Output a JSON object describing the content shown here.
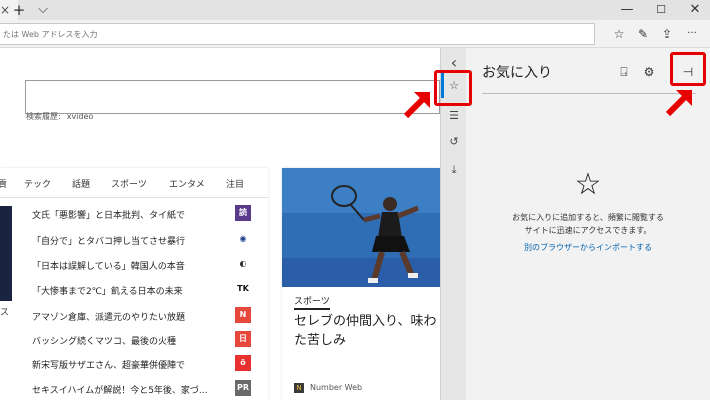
{
  "titlebar": {
    "new_tab_icon": "plus-icon",
    "new_tab_glyph": "+",
    "tab_list_glyph": "⌵",
    "tab_close_glyph": "×",
    "minimize_glyph": "—",
    "maximize_glyph": "☐",
    "close_glyph": "✕"
  },
  "address_bar": {
    "placeholder": "たは Web アドレスを入力",
    "favorites_star_glyph": "☆",
    "notes_glyph": "✎",
    "share_glyph": "⇪",
    "more_glyph": "···"
  },
  "search": {
    "history_label": "検索履歴:",
    "history_item": "xvideo"
  },
  "news": {
    "tabs": [
      "貢",
      "テック",
      "話題",
      "スポーツ",
      "エンタメ",
      "注目"
    ],
    "left_text": "ス",
    "headlines": [
      {
        "text": "文氏「悪影響」と日本批判、タイ紙で",
        "logo": "読",
        "logo_color": "#5b3a8c",
        "logo_text_color": "#ffffff"
      },
      {
        "text": "「自分で」とタバコ押し当てさせ暴行",
        "logo": "◉",
        "logo_color": "#ffffff",
        "logo_text_color": "#1a3e8c"
      },
      {
        "text": "「日本は誤解している」韓国人の本音",
        "logo": "◐",
        "logo_color": "#ffffff",
        "logo_text_color": "#333333"
      },
      {
        "text": "「大惨事まで2℃」飢える日本の未来",
        "logo": "TK",
        "logo_color": "#ffffff",
        "logo_text_color": "#111111"
      },
      {
        "text": "アマゾン倉庫、派遣元のやりたい放題",
        "logo": "N",
        "logo_color": "#e8483b",
        "logo_text_color": "#ffffff"
      },
      {
        "text": "バッシング続くマツコ、最後の火種",
        "logo": "日",
        "logo_color": "#e8483b",
        "logo_text_color": "#ffffff"
      },
      {
        "text": "新宋写版サザエさん、超豪華併優陣で",
        "logo": "ö",
        "logo_color": "#e83030",
        "logo_text_color": "#ffffff"
      },
      {
        "text": "セキスイハイムが解説！今と5年後、家づ...",
        "logo": "PR",
        "logo_color": "#6a6a6a",
        "logo_text_color": "#ffffff"
      }
    ]
  },
  "feature": {
    "category": "スポーツ",
    "title_line1": "セレブの仲間入り、味わ",
    "title_line2": "た苦しみ",
    "source_icon": "N",
    "source": "Number Web"
  },
  "hub": {
    "back_glyph": "‹",
    "favorites_glyph": "☆",
    "reading_list_glyph": "☰",
    "history_glyph": "↺",
    "downloads_glyph": "⤓"
  },
  "favorites": {
    "title": "お気に入り",
    "import_glyph": "⍈",
    "settings_glyph": "⚙",
    "pin_glyph": "⊣",
    "empty_star": "☆",
    "message_line1": "お気に入りに追加すると、頻繁に閲覧する",
    "message_line2": "サイトに迅速にアクセスできます。",
    "import_link": "別のブラウザーからインポートする"
  },
  "colors": {
    "accent": "#0078d7",
    "annotation": "#e60000",
    "link": "#0063b1"
  }
}
